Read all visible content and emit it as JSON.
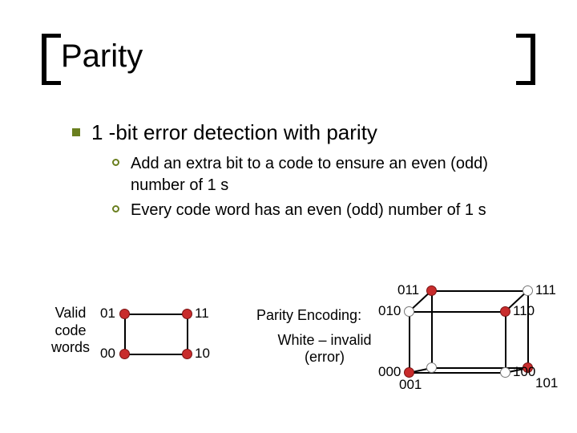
{
  "title": "Parity",
  "bullets": {
    "l1": "1 -bit error detection with parity",
    "l2": [
      "Add an extra bit to a code to ensure an even (odd) number of 1 s",
      "Every code word has an even (odd)  number of 1 s"
    ]
  },
  "vcw_label": "Valid code words",
  "square": {
    "tl": "01",
    "tr": "11",
    "bl": "00",
    "br": "10"
  },
  "encoding": {
    "heading": "Parity Encoding:",
    "note": "White – invalid (error)"
  },
  "cube": {
    "btl": "011",
    "btr": "111",
    "ftl": "010",
    "ftr": "110",
    "bbl": "001",
    "bbr": "101",
    "fbl": "000",
    "fbr": "100"
  }
}
